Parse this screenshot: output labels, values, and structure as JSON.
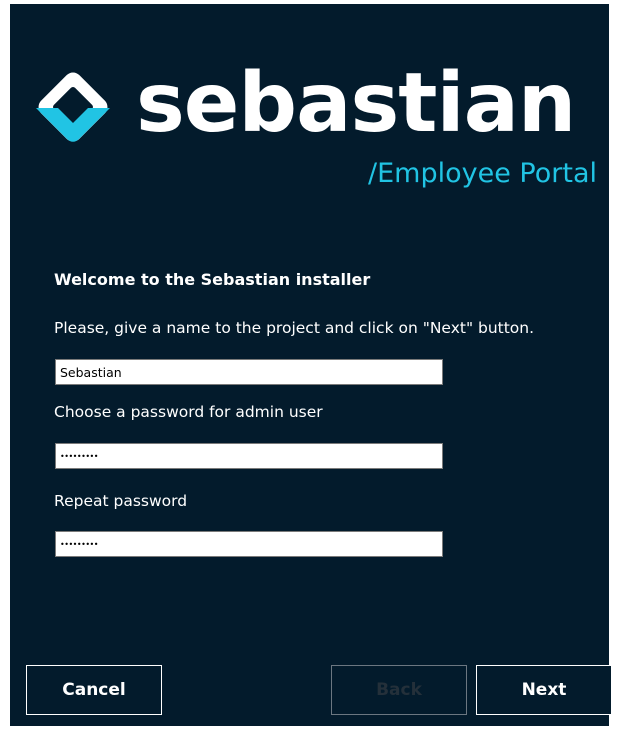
{
  "brand": {
    "name": "sebastian",
    "subtitle": "/Employee Portal",
    "accent_color": "#21c4e4",
    "background_color": "#031b2c"
  },
  "form": {
    "heading": "Welcome to the Sebastian installer",
    "instruction": "Please, give a name to the project and click on \"Next\" button.",
    "project_name_value": "Sebastian",
    "password_label": "Choose a password for admin user",
    "password_value": "•••••••••",
    "repeat_label": "Repeat password",
    "repeat_value": "•••••••••"
  },
  "buttons": {
    "cancel": "Cancel",
    "back": "Back",
    "next": "Next"
  }
}
